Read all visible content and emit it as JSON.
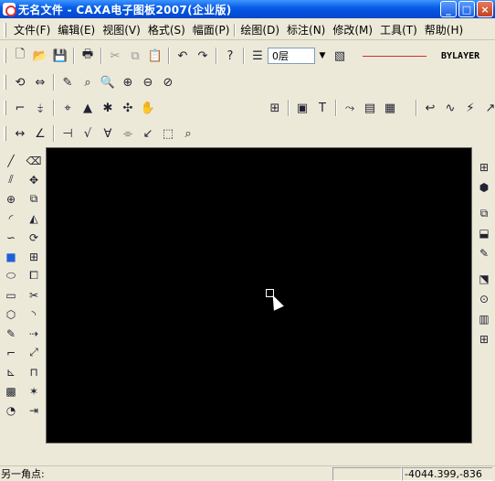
{
  "window": {
    "title": "无名文件 - CAXA电子图板2007(企业版)",
    "minimize": "_",
    "maximize": "□",
    "close": "×"
  },
  "menu": [
    "文件(F)",
    "编辑(E)",
    "视图(V)",
    "格式(S)",
    "幅面(P)",
    "绘图(D)",
    "标注(N)",
    "修改(M)",
    "工具(T)",
    "帮助(H)"
  ],
  "toolbar": {
    "layer_value": "0层",
    "linetype_color": "#d03030",
    "lineweight_value": "BYLAYER"
  },
  "status": {
    "prompt": "另一角点:",
    "coordinates": "-4044.399,-836"
  },
  "colors": {
    "canvas": "#000000",
    "titlebar": "#0a5ee6",
    "background": "#ece9d8"
  }
}
